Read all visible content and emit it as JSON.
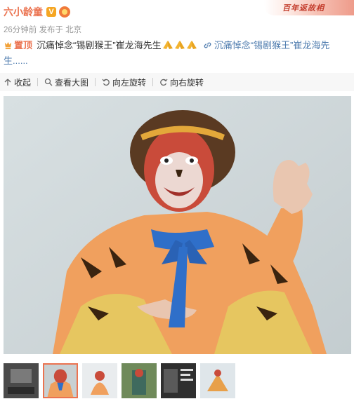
{
  "post": {
    "username": "六小龄童",
    "banner_text": "百年返故相",
    "meta": "26分钟前 发布于 北京",
    "pin_label": "置顶",
    "body_text": "沉痛悼念“锡剧猴王”崔龙海先生",
    "link_text": "沉痛悼念“锡剧猴王”崔龙海先生......",
    "emoji": [
      "praying-hands",
      "praying-hands",
      "praying-hands"
    ]
  },
  "toolbar": {
    "collapse": "收起",
    "view_large": "查看大图",
    "rotate_left": "向左旋转",
    "rotate_right": "向右旋转"
  },
  "photo": {
    "subject": "monkey-king-opera-performer"
  },
  "thumbnails": {
    "count": 6,
    "active_index": 1
  },
  "colors": {
    "username": "#eb7350",
    "link": "#507daf",
    "meta": "#999999",
    "toolbar_bg": "#f7f7f7",
    "active_thumb_border": "#eb7350"
  }
}
